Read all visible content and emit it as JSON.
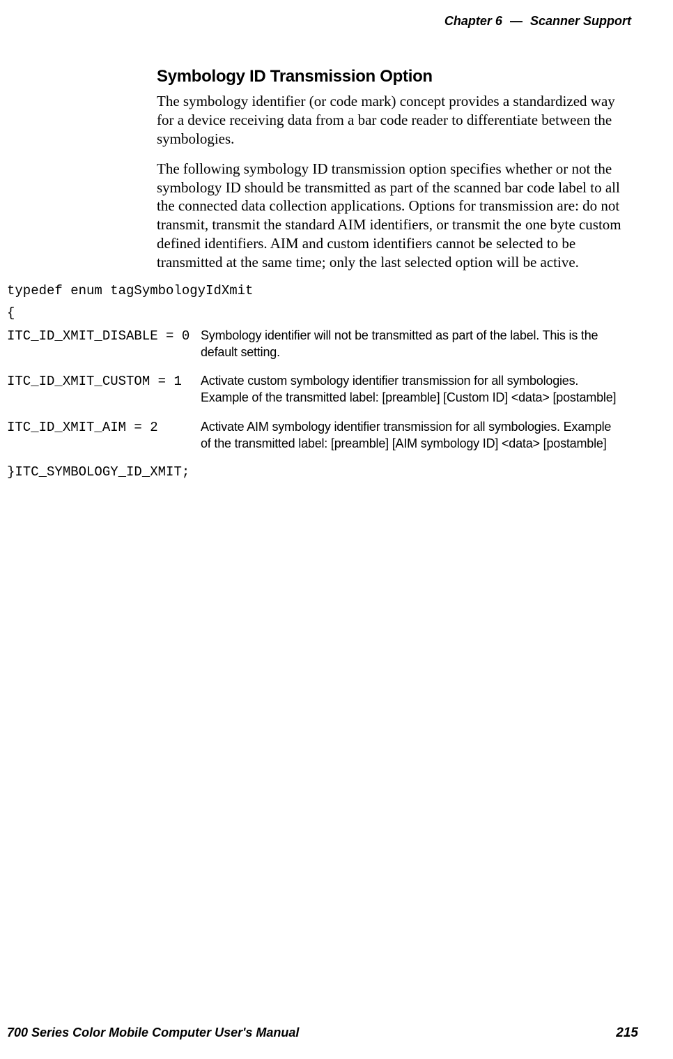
{
  "header": {
    "chapter_label": "Chapter",
    "chapter_num": "6",
    "separator": "—",
    "chapter_title": "Scanner Support"
  },
  "section": {
    "title": "Symbology ID Transmission Option",
    "para1": "The symbology identifier (or code mark) concept provides a standardized way for a device receiving data from a bar code reader to differentiate between the symbologies.",
    "para2": "The following symbology ID transmission option specifies whether or not the symbology ID should be transmitted as part of the scanned bar code label to all the connected data collection applications. Options for transmission are: do not transmit, transmit the standard AIM identifiers, or transmit the one byte custom defined identifiers. AIM and custom identifiers cannot be selected to be transmitted at the same time; only the last selected option will be active."
  },
  "code": {
    "typedef_line": "typedef enum tagSymbologyIdXmit",
    "open_brace": "{",
    "close_line": "}ITC_SYMBOLOGY_ID_XMIT;"
  },
  "enum_items": [
    {
      "code": "ITC_ID_XMIT_DISABLE = 0",
      "desc": "Symbology identifier will not be transmitted as part of the label. This is the default setting."
    },
    {
      "code": "ITC_ID_XMIT_CUSTOM = 1",
      "desc": "Activate custom symbology identifier transmission for all symbologies. Example of the transmitted label: [preamble] [Custom ID] <data> [postamble]"
    },
    {
      "code": "ITC_ID_XMIT_AIM = 2",
      "desc": "Activate AIM symbology identifier transmission for all symbologies. Example of the transmitted label: [preamble] [AIM symbology ID] <data> [postamble]"
    }
  ],
  "footer": {
    "manual_title": "700 Series Color Mobile Computer User's Manual",
    "page_number": "215"
  }
}
